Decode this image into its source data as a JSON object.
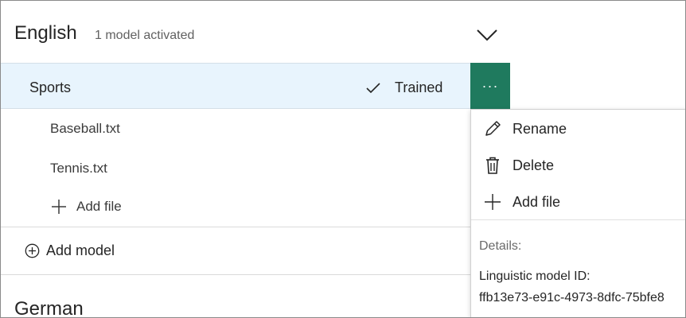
{
  "language": {
    "title": "English",
    "subtitle": "1 model activated",
    "expand_icon": "chevron-down-icon"
  },
  "model": {
    "name": "Sports",
    "status": "Trained",
    "status_icon": "check-icon",
    "more_label": "···",
    "accent_color": "#1f7a5e",
    "row_background": "#e8f4fd"
  },
  "files": [
    "Baseball.txt",
    "Tennis.txt"
  ],
  "add_file_label": "Add file",
  "add_model_label": "Add model",
  "next_language": "German",
  "context_menu": {
    "items": [
      {
        "label": "Rename",
        "icon": "pencil-icon"
      },
      {
        "label": "Delete",
        "icon": "trash-icon"
      },
      {
        "label": "Add file",
        "icon": "plus-icon"
      }
    ],
    "details_label": "Details:",
    "linguistic_model_label": "Linguistic model ID:",
    "linguistic_model_id": "ffb13e73-e91c-4973-8dfc-75bfe8"
  }
}
